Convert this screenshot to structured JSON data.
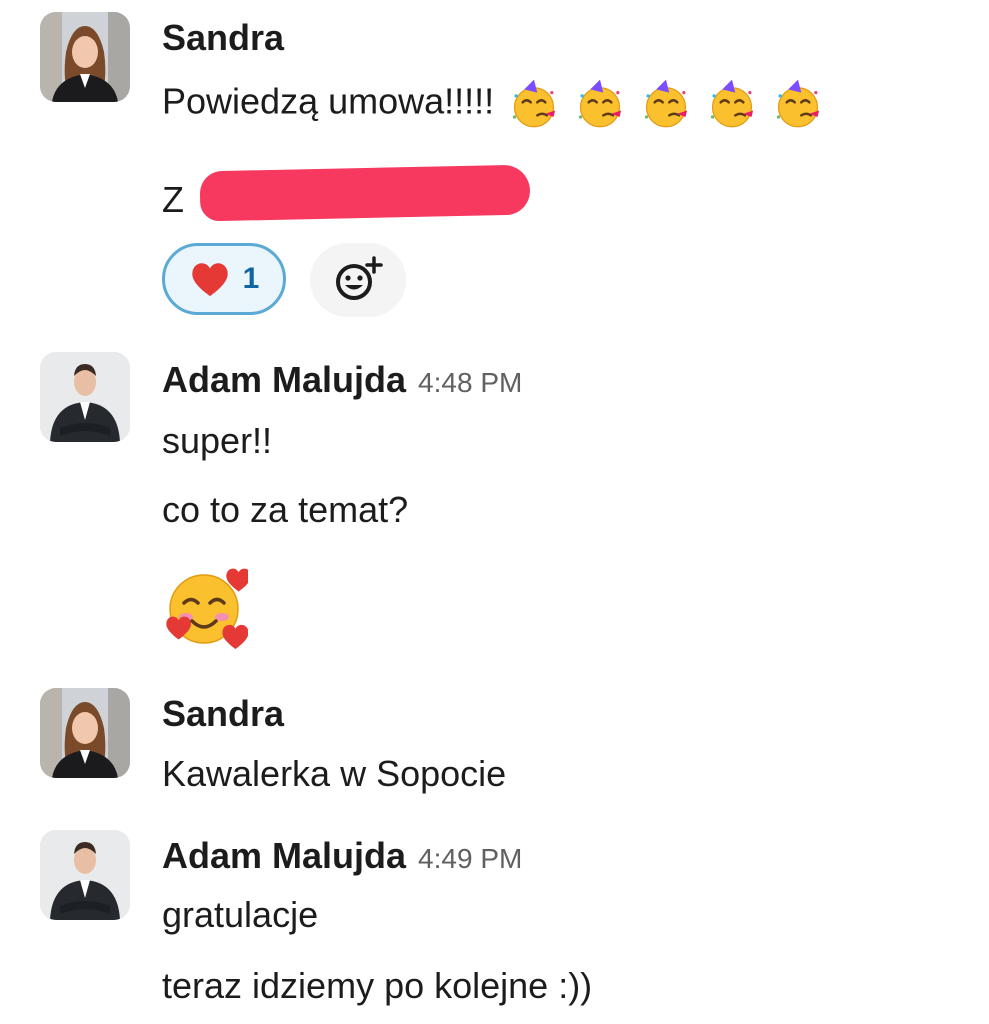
{
  "messages": [
    {
      "author": "Sandra",
      "time": "",
      "lines": [
        "Powiedzą umowa!!!!!",
        "Z"
      ],
      "emoji_icons": [
        "partying-face-icon",
        "partying-face-icon",
        "partying-face-icon",
        "partying-face-icon",
        "partying-face-icon"
      ],
      "reaction": {
        "icon": "red-heart-icon",
        "count": "1"
      },
      "add_reaction_icon": "add-reaction-icon"
    },
    {
      "author": "Adam Malujda",
      "time": "4:48 PM",
      "lines": [
        "super!!",
        "co to za temat?"
      ],
      "big_emoji_icon": "smiling-face-with-hearts-icon"
    },
    {
      "author": "Sandra",
      "time": "",
      "lines": [
        "Kawalerka w Sopocie"
      ]
    },
    {
      "author": "Adam Malujda",
      "time": "4:49 PM",
      "lines": [
        "gratulacje",
        "teraz idziemy po kolejne :))"
      ]
    }
  ],
  "colors": {
    "reaction_border": "#5aa9d6",
    "reaction_count": "#1264a3",
    "redaction": "#f7395f",
    "timestamp": "#616061"
  }
}
